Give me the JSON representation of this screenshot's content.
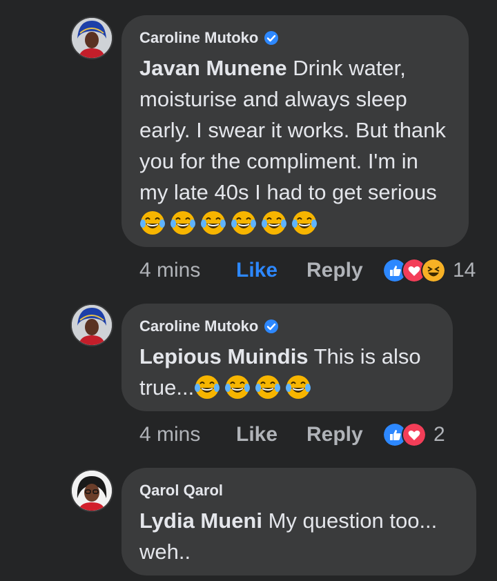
{
  "comments": [
    {
      "author": "Caroline Mutoko",
      "verified": true,
      "mention": "Javan Munene",
      "text": " Drink water, moisturise and always sleep early. I swear it works. But thank you for the compliment. I'm in my late 40s I had to get serious",
      "emoji_count": 6,
      "time": "4 mins",
      "like_label": "Like",
      "liked": true,
      "reply_label": "Reply",
      "reactions": [
        "like-icon",
        "love-icon",
        "haha-icon"
      ],
      "reaction_count": "14"
    },
    {
      "author": "Caroline Mutoko",
      "verified": true,
      "mention": "Lepious Muindis",
      "text": " This is also true...",
      "emoji_count": 4,
      "time": "4 mins",
      "like_label": "Like",
      "liked": false,
      "reply_label": "Reply",
      "reactions": [
        "like-icon",
        "love-icon"
      ],
      "reaction_count": "2"
    },
    {
      "author": "Qarol Qarol",
      "verified": false,
      "mention": "Lydia Mueni",
      "text": " My question too... weh..",
      "emoji_count": 0
    }
  ],
  "colors": {
    "background": "#242526",
    "bubble": "#3a3b3c",
    "text": "#e4e6eb",
    "muted": "#b0b3b8",
    "accent": "#2d88ff"
  }
}
